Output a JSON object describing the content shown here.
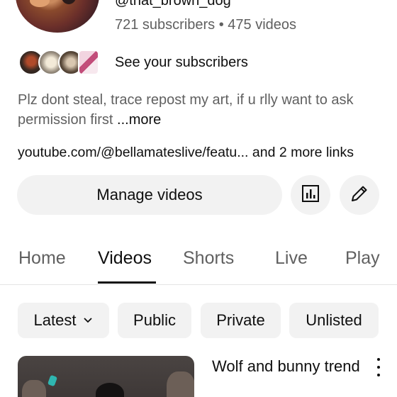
{
  "channel": {
    "handle": "@that_brown_dog",
    "stats": "721 subscribers • 475 videos",
    "see_subscribers": "See your subscribers",
    "bio_text": "Plz dont steal, trace repost my art, if u rlly want to ask permission first",
    "bio_more": "...more",
    "links": "youtube.com/@bellamateslive/featu... and 2 more links"
  },
  "actions": {
    "manage_videos": "Manage videos",
    "analytics_icon": "analytics-icon",
    "edit_icon": "pencil-icon"
  },
  "tabs": [
    {
      "label": "Home",
      "active": false
    },
    {
      "label": "Videos",
      "active": true
    },
    {
      "label": "Shorts",
      "active": false
    },
    {
      "label": "Live",
      "active": false
    },
    {
      "label": "Play",
      "active": false
    }
  ],
  "filters": {
    "sort": "Latest",
    "chips": [
      "Public",
      "Private",
      "Unlisted"
    ]
  },
  "videos": [
    {
      "title": "Wolf and bunny trend"
    }
  ]
}
